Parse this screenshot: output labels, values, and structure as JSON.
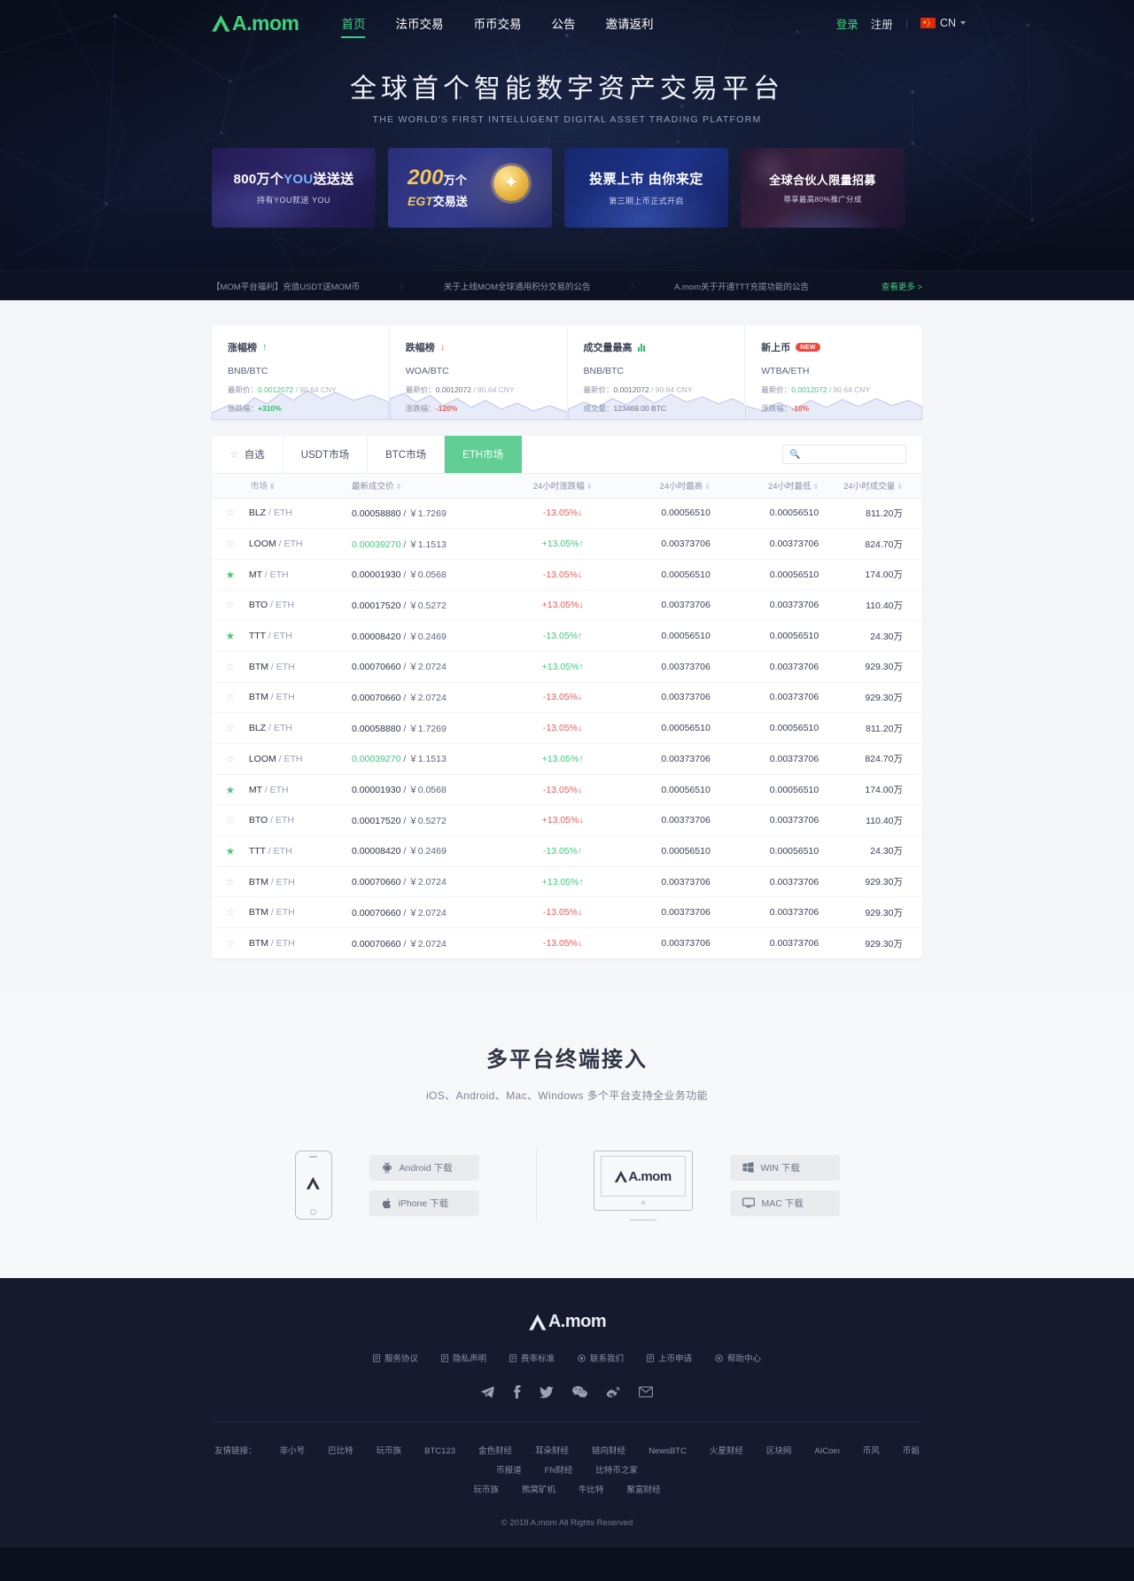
{
  "brand": {
    "name": "A.mom",
    "accent": "#3fd07b"
  },
  "nav": {
    "links": [
      {
        "label": "首页",
        "active": true
      },
      {
        "label": "法币交易",
        "active": false
      },
      {
        "label": "币币交易",
        "active": false
      },
      {
        "label": "公告",
        "active": false
      },
      {
        "label": "邀请返利",
        "active": false
      }
    ],
    "login": "登录",
    "register": "注册",
    "separator": "|",
    "language": "CN"
  },
  "hero": {
    "title": "全球首个智能数字资产交易平台",
    "subtitle": "THE WORLD'S FIRST INTELLIGENT DIGITAL ASSET TRADING PLATFORM"
  },
  "banners": [
    {
      "line1_a": "800万个",
      "line1_hl": "YOU",
      "line1_b": "送送送",
      "line2": "持有YOU就送 YOU"
    },
    {
      "num": "200",
      "unit": "万个",
      "line2_a": "EGT",
      "line2_b": "交易送"
    },
    {
      "line1": "投票上市 由你来定",
      "line2": "第三期上币正式开启"
    },
    {
      "line1": "全球合伙人限量招募",
      "line2": "尊享最高80%推广分成"
    }
  ],
  "announcements": {
    "items": [
      "【MOM平台福利】充值USDT送MOM币",
      "关于上线MOM全球通用积分交易的公告",
      "A.mom关于开通TTT充提功能的公告"
    ],
    "divider": "/",
    "more": "查看更多 >"
  },
  "stats": [
    {
      "title": "涨幅榜",
      "icon": "arrow-up-icon",
      "badge": null,
      "pair": "BNB/BTC",
      "row1_label": "最新价：",
      "row1_value": "0.0012072",
      "row1_sep": " / ",
      "row1_cny": "90.64 CNY",
      "row2_label": "涨跌幅：",
      "row2_value": "+310%",
      "row2_dir": "up"
    },
    {
      "title": "跌幅榜",
      "icon": "arrow-down-icon",
      "badge": null,
      "pair": "WOA/BTC",
      "row1_label": "最新价：",
      "row1_value": "0.0012072",
      "row1_sep": " / ",
      "row1_cny": "90.64 CNY",
      "row2_label": "涨跌幅：",
      "row2_value": "-120%",
      "row2_dir": "down"
    },
    {
      "title": "成交量最高",
      "icon": "bar-chart-icon",
      "badge": null,
      "pair": "BNB/BTC",
      "row1_label": "最新价：",
      "row1_value": "0.0012072",
      "row1_sep": " / ",
      "row1_cny": "90.64 CNY",
      "row2_label": "成交量：",
      "row2_value": "123469.00 BTC",
      "row2_dir": "neutral"
    },
    {
      "title": "新上币",
      "icon": null,
      "badge": "NEW",
      "pair": "WTBA/ETH",
      "row1_label": "最新价：",
      "row1_value": "0.0012072",
      "row1_sep": " / ",
      "row1_cny": "90.64 CNY",
      "row2_label": "涨跌幅：",
      "row2_value": "-10%",
      "row2_dir": "down"
    }
  ],
  "market": {
    "tabs": [
      {
        "label": "自选",
        "icon": "star-icon",
        "active": false
      },
      {
        "label": "USDT市场",
        "icon": null,
        "active": false
      },
      {
        "label": "BTC市场",
        "icon": null,
        "active": false
      },
      {
        "label": "ETH市场",
        "icon": null,
        "active": true
      }
    ],
    "search": {
      "placeholder": "",
      "value": ""
    },
    "columns": [
      "市场",
      "最新成交价",
      "24小时涨跌幅",
      "24小时最高",
      "24小时最低",
      "24小时成交量"
    ],
    "rows": [
      {
        "fav": false,
        "base": "BLZ",
        "quote": "/ ETH",
        "price": "0.00058880",
        "price_color": "dark",
        "cny": "/ ￥1.7269",
        "change": "-13.05%",
        "dir": "down",
        "high": "0.00056510",
        "low": "0.00056510",
        "vol": "811.20万"
      },
      {
        "fav": false,
        "base": "LOOM",
        "quote": "/ ETH",
        "price": "0.00039270",
        "price_color": "green",
        "cny": "/ ￥1.1513",
        "change": "+13.05%",
        "dir": "up",
        "high": "0.00373706",
        "low": "0.00373706",
        "vol": "824.70万"
      },
      {
        "fav": true,
        "base": "MT",
        "quote": "/ ETH",
        "price": "0.00001930",
        "price_color": "dark",
        "cny": "/ ￥0.0568",
        "change": "-13.05%",
        "dir": "down",
        "high": "0.00056510",
        "low": "0.00056510",
        "vol": "174.00万"
      },
      {
        "fav": false,
        "base": "BTO",
        "quote": "/ ETH",
        "price": "0.00017520",
        "price_color": "dark",
        "cny": "/ ￥0.5272",
        "change": "+13.05%",
        "dir": "down",
        "high": "0.00373706",
        "low": "0.00373706",
        "vol": "110.40万"
      },
      {
        "fav": true,
        "base": "TTT",
        "quote": "/ ETH",
        "price": "0.00008420",
        "price_color": "dark",
        "cny": "/ ￥0.2469",
        "change": "-13.05%",
        "dir": "up",
        "high": "0.00056510",
        "low": "0.00056510",
        "vol": "24.30万"
      },
      {
        "fav": false,
        "base": "BTM",
        "quote": "/ ETH",
        "price": "0.00070660",
        "price_color": "dark",
        "cny": "/ ￥2.0724",
        "change": "+13.05%",
        "dir": "up",
        "high": "0.00373706",
        "low": "0.00373706",
        "vol": "929.30万"
      },
      {
        "fav": false,
        "base": "BTM",
        "quote": "/ ETH",
        "price": "0.00070660",
        "price_color": "dark",
        "cny": "/ ￥2.0724",
        "change": "-13.05%",
        "dir": "down",
        "high": "0.00373706",
        "low": "0.00373706",
        "vol": "929.30万"
      },
      {
        "fav": false,
        "base": "BLZ",
        "quote": "/ ETH",
        "price": "0.00058880",
        "price_color": "dark",
        "cny": "/ ￥1.7269",
        "change": "-13.05%",
        "dir": "down",
        "high": "0.00056510",
        "low": "0.00056510",
        "vol": "811.20万"
      },
      {
        "fav": false,
        "base": "LOOM",
        "quote": "/ ETH",
        "price": "0.00039270",
        "price_color": "green",
        "cny": "/ ￥1.1513",
        "change": "+13.05%",
        "dir": "up",
        "high": "0.00373706",
        "low": "0.00373706",
        "vol": "824.70万"
      },
      {
        "fav": true,
        "base": "MT",
        "quote": "/ ETH",
        "price": "0.00001930",
        "price_color": "dark",
        "cny": "/ ￥0.0568",
        "change": "-13.05%",
        "dir": "down",
        "high": "0.00056510",
        "low": "0.00056510",
        "vol": "174.00万"
      },
      {
        "fav": false,
        "base": "BTO",
        "quote": "/ ETH",
        "price": "0.00017520",
        "price_color": "dark",
        "cny": "/ ￥0.5272",
        "change": "+13.05%",
        "dir": "down",
        "high": "0.00373706",
        "low": "0.00373706",
        "vol": "110.40万"
      },
      {
        "fav": true,
        "base": "TTT",
        "quote": "/ ETH",
        "price": "0.00008420",
        "price_color": "dark",
        "cny": "/ ￥0.2469",
        "change": "-13.05%",
        "dir": "up",
        "high": "0.00056510",
        "low": "0.00056510",
        "vol": "24.30万"
      },
      {
        "fav": false,
        "base": "BTM",
        "quote": "/ ETH",
        "price": "0.00070660",
        "price_color": "dark",
        "cny": "/ ￥2.0724",
        "change": "+13.05%",
        "dir": "up",
        "high": "0.00373706",
        "low": "0.00373706",
        "vol": "929.30万"
      },
      {
        "fav": false,
        "base": "BTM",
        "quote": "/ ETH",
        "price": "0.00070660",
        "price_color": "dark",
        "cny": "/ ￥2.0724",
        "change": "-13.05%",
        "dir": "down",
        "high": "0.00373706",
        "low": "0.00373706",
        "vol": "929.30万"
      },
      {
        "fav": false,
        "base": "BTM",
        "quote": "/ ETH",
        "price": "0.00070660",
        "price_color": "dark",
        "cny": "/ ￥2.0724",
        "change": "-13.05%",
        "dir": "down",
        "high": "0.00373706",
        "low": "0.00373706",
        "vol": "929.30万"
      }
    ]
  },
  "download": {
    "title": "多平台终端接入",
    "subtitle": "iOS、Android、Mac、Windows 多个平台支持全业务功能",
    "mobile_buttons": [
      {
        "label": "Android 下载",
        "icon": "android-icon"
      },
      {
        "label": "iPhone 下载",
        "icon": "apple-icon"
      }
    ],
    "desktop_buttons": [
      {
        "label": "WIN 下载",
        "icon": "windows-icon"
      },
      {
        "label": "MAC 下载",
        "icon": "monitor-icon"
      }
    ],
    "monitor_logo": "A.mom"
  },
  "footer": {
    "logo": "A.mom",
    "links": [
      {
        "label": "服务协议",
        "icon": "doc-icon"
      },
      {
        "label": "隐私声明",
        "icon": "doc-icon"
      },
      {
        "label": "费率标准",
        "icon": "doc-icon"
      },
      {
        "label": "联系我们",
        "icon": "contact-icon"
      },
      {
        "label": "上币申请",
        "icon": "doc-icon"
      },
      {
        "label": "帮助中心",
        "icon": "help-icon"
      }
    ],
    "social": [
      "telegram-icon",
      "facebook-icon",
      "twitter-icon",
      "wechat-icon",
      "weibo-icon",
      "mail-icon"
    ],
    "friends_label": "友情链接：",
    "friends_row1": [
      "非小号",
      "巴比特",
      "玩币族",
      "BTC123",
      "金色财经",
      "耳朵财经",
      "链向财经",
      "NewsBTC",
      "火星财经",
      "区块网",
      "AICoin",
      "币风",
      "币姐",
      "币报道",
      "FN财经",
      "比特币之家"
    ],
    "friends_row2": [
      "玩币族",
      "熊窝矿机",
      "牛比特",
      "聚富财经"
    ],
    "copyright": "© 2018 A.mom All Rights Reserved"
  }
}
